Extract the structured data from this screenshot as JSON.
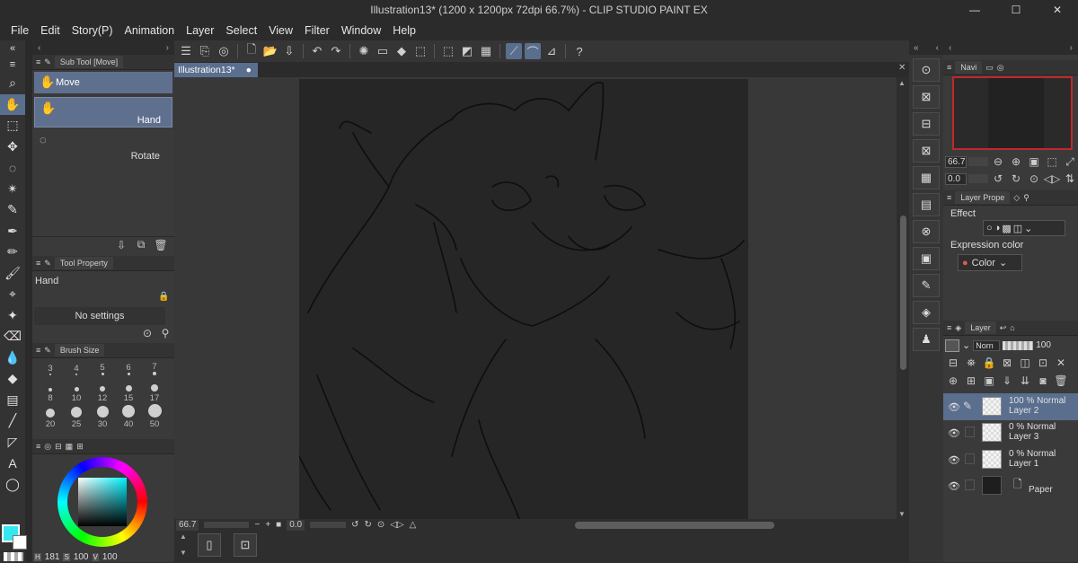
{
  "window": {
    "title": "Illustration13* (1200 x 1200px 72dpi 66.7%)  - CLIP STUDIO PAINT EX",
    "minimize": "—",
    "maximize": "☐",
    "close": "✕"
  },
  "menu": [
    "File",
    "Edit",
    "Story(P)",
    "Animation",
    "Layer",
    "Select",
    "View",
    "Filter",
    "Window",
    "Help"
  ],
  "document_tab": {
    "label": "Illustration13*",
    "dot": "●"
  },
  "subtool_panel": {
    "tab": "Sub Tool [Move]",
    "group": "Move",
    "items": [
      {
        "label": "Hand",
        "selected": true
      },
      {
        "label": "Rotate",
        "selected": false
      }
    ]
  },
  "tool_property": {
    "tab": "Tool Property",
    "tool_name": "Hand",
    "message": "No settings"
  },
  "brush_size": {
    "tab": "Brush Size",
    "sizes": [
      "3",
      "4",
      "5",
      "6",
      "7",
      "8",
      "10",
      "12",
      "15",
      "17",
      "20",
      "25",
      "30",
      "40",
      "50"
    ]
  },
  "color": {
    "current": "#33e8f2",
    "secondary": "#ffffff",
    "hsv": {
      "h_label": "H",
      "h": "181",
      "s_label": "S",
      "s": "100",
      "v_label": "V",
      "v": "100"
    }
  },
  "status": {
    "zoom": "66.7",
    "minus": "−",
    "plus": "+",
    "rotation": "0.0"
  },
  "navigator": {
    "tab": "Navi",
    "zoom": "66.7",
    "rotation": "0.0"
  },
  "layer_property": {
    "tab": "Layer Prope",
    "effect_label": "Effect",
    "expression_label": "Expression color",
    "expression_value": "Color"
  },
  "layer_panel": {
    "tab": "Layer",
    "blend_mode": "Norn",
    "opacity": "100",
    "layers": [
      {
        "mode": "100 % Normal",
        "name": "Layer 2",
        "selected": true
      },
      {
        "mode": "0 % Normal",
        "name": "Layer 3",
        "selected": false
      },
      {
        "mode": "0 % Normal",
        "name": "Layer 1",
        "selected": false
      },
      {
        "mode": "",
        "name": "Paper",
        "selected": false
      }
    ]
  }
}
